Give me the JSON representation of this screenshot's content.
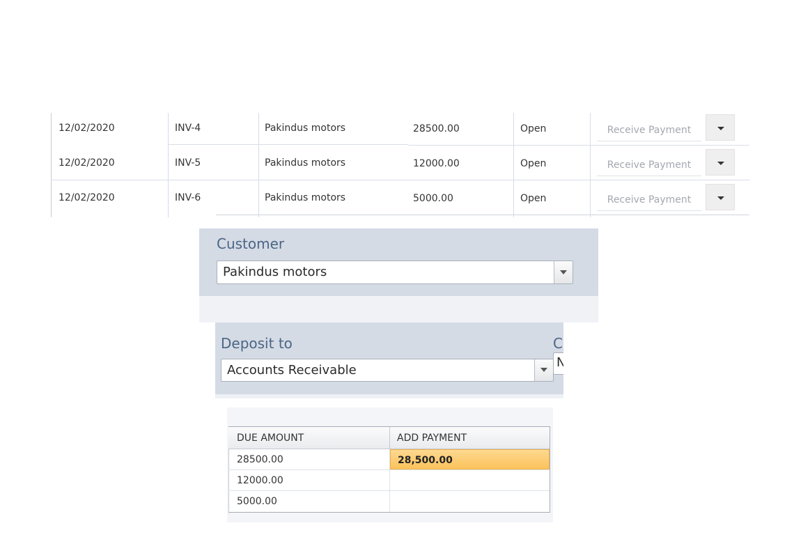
{
  "invoices": [
    {
      "date": "12/02/2020",
      "number": "INV-4",
      "customer": "Pakindus motors",
      "amount": "28500.00",
      "status": "Open",
      "action": "Receive Payment"
    },
    {
      "date": "12/02/2020",
      "number": "INV-5",
      "customer": "Pakindus motors",
      "amount": "12000.00",
      "status": "Open",
      "action": "Receive Payment"
    },
    {
      "date": "12/02/2020",
      "number": "INV-6",
      "customer": "Pakindus motors",
      "amount": "5000.00",
      "status": "Open",
      "action": "Receive Payment"
    }
  ],
  "customer_form": {
    "label": "Customer",
    "value": "Pakindus motors"
  },
  "deposit_form": {
    "label": "Deposit to",
    "value": "Accounts Receivable",
    "clipped_label": "C",
    "clipped_value": "N"
  },
  "payment_grid": {
    "headers": {
      "due_amount": "DUE AMOUNT",
      "add_payment": "ADD PAYMENT"
    },
    "rows": [
      {
        "due_amount": "28500.00",
        "add_payment": "28,500.00"
      },
      {
        "due_amount": "12000.00",
        "add_payment": ""
      },
      {
        "due_amount": "5000.00",
        "add_payment": ""
      }
    ]
  },
  "colors": {
    "panel_bg": "#d4dbe5",
    "label": "#4c6585",
    "active_cell": "#fbc25c"
  }
}
